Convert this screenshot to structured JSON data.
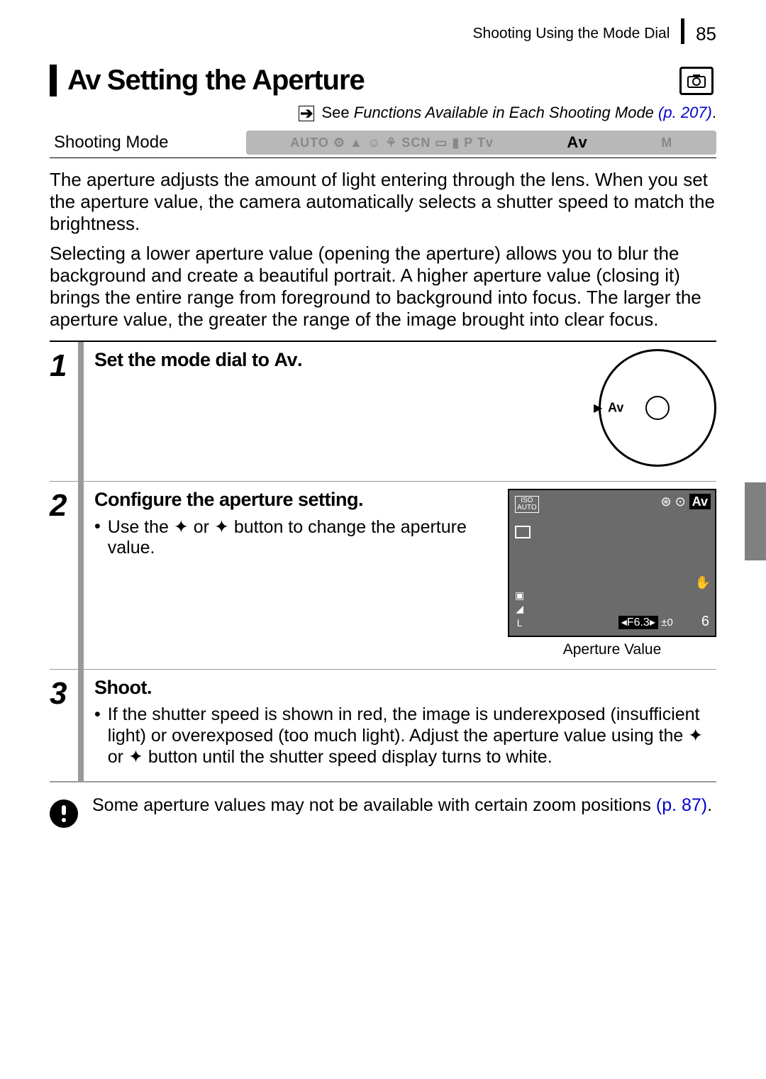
{
  "header": {
    "breadcrumb": "Shooting Using the Mode Dial",
    "page_number": "85"
  },
  "title": {
    "prefix": "Av",
    "text": "Setting the Aperture"
  },
  "see_line": {
    "arrow": "➔",
    "prefix": "See ",
    "italic": "Functions Available in Each Shooting Mode ",
    "link": "(p. 207)",
    "suffix": "."
  },
  "shooting_mode_label": "Shooting Mode",
  "mode_icons_text": "AUTO  ⚙  ▲  ☺  ⚘  SCN  ▭  ▮  P  Tv",
  "mode_icons_av": "Av",
  "mode_icons_m": "M",
  "paragraph1": "The aperture adjusts the amount of light entering through the lens. When you set the aperture value, the camera automatically selects a shutter speed to match the brightness.",
  "paragraph2": "Selecting a lower aperture value (opening the aperture) allows you to blur the background and create a beautiful portrait. A higher aperture value (closing it) brings the entire range from foreground to background into focus. The larger the aperture value, the greater the range of the image brought into clear focus.",
  "steps": [
    {
      "num": "1",
      "title_pre": "Set the mode dial to ",
      "title_mode": "Av",
      "title_post": ".",
      "bullets": [],
      "dial_label": "Av"
    },
    {
      "num": "2",
      "title": "Configure the aperture setting.",
      "bullet_pre": "Use the ",
      "bullet_mid": " or ",
      "bullet_post": " button to change the aperture value.",
      "lcd": {
        "iso_top": "ISO",
        "iso_bot": "AUTO",
        "av": "Av",
        "f_value": "◂F6.3▸",
        "exp": "±0",
        "six": "6"
      },
      "caption": "Aperture Value"
    },
    {
      "num": "3",
      "title": "Shoot.",
      "bullet_pre": "If the shutter speed is shown in red, the image is underexposed (insufficient light) or overexposed (too much light). Adjust the aperture value using the ",
      "bullet_mid": " or ",
      "bullet_post": " button until the shutter speed display turns to white."
    }
  ],
  "note": {
    "text_pre": "Some aperture values may not be available with certain zoom positions ",
    "link": "(p. 87)",
    "text_post": "."
  }
}
